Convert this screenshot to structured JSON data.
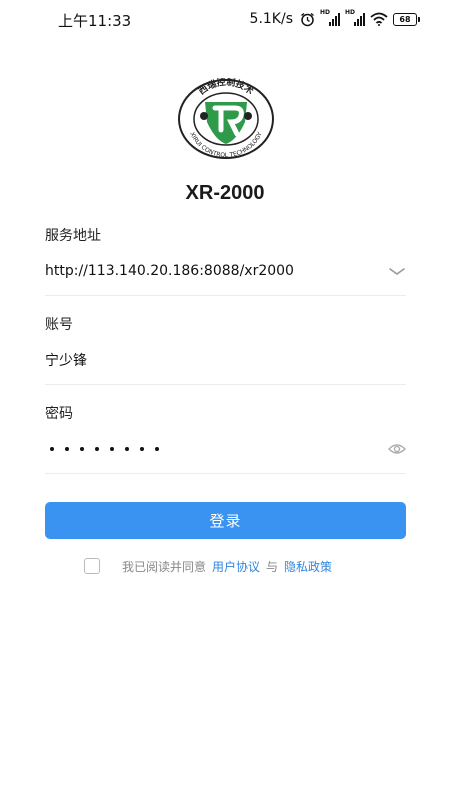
{
  "status_bar": {
    "time": "上午11:33",
    "speed": "5.1K/s",
    "sim1_tag": "HD",
    "sim2_tag": "HD",
    "battery": "68",
    "icons": [
      "alarm-icon",
      "signal-icon",
      "signal-icon",
      "wifi-icon",
      "battery-icon"
    ]
  },
  "logo": {
    "text_top": "西瑞控制技术",
    "text_bottom": "XIRUI CONTROL TECHNOLOGY"
  },
  "app_title": "XR-2000",
  "server": {
    "label": "服务地址",
    "value": "http://113.140.20.186:8088/xr2000"
  },
  "account": {
    "label": "账号",
    "value": "宁少锋"
  },
  "password": {
    "label": "密码",
    "masked_length": 8
  },
  "login_button": "登录",
  "agreement": {
    "prefix": "我已阅读并同意",
    "user_agreement": "用户协议",
    "conjunction": "与",
    "privacy_policy": "隐私政策",
    "checked": false
  },
  "colors": {
    "primary": "#3a93f0",
    "link": "#2f86de",
    "logo_green": "#2e9a4a"
  }
}
